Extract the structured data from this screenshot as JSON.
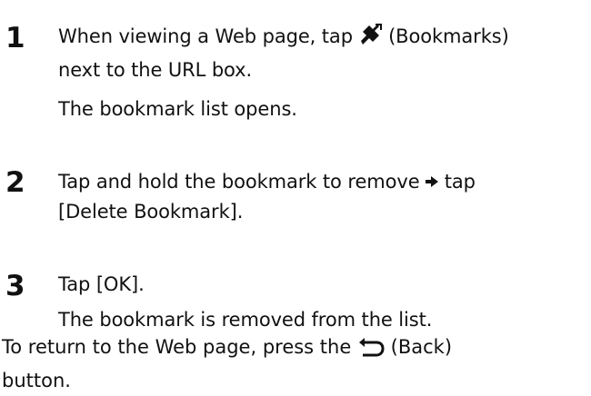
{
  "steps": [
    {
      "number": "1",
      "instruction_prefix": "When viewing a Web page, tap",
      "icon_label": "(Bookmarks)",
      "instruction_line2": "next to the URL box.",
      "result": "The bookmark list opens."
    },
    {
      "number": "2",
      "instruction_prefix": "Tap and hold the bookmark to remove",
      "instruction_suffix": "tap",
      "instruction_line2": "[Delete Bookmark]."
    },
    {
      "number": "3",
      "instruction": "Tap [OK].",
      "result": "The bookmark is removed from the list."
    }
  ],
  "note": {
    "prefix": "To return to the Web page, press the",
    "icon_label": "(Back)",
    "line2": "button."
  },
  "icons": {
    "bookmarks": "bookmark-ribbon-icon",
    "arrow": "right-arrow-icon",
    "back": "back-arrow-icon"
  }
}
